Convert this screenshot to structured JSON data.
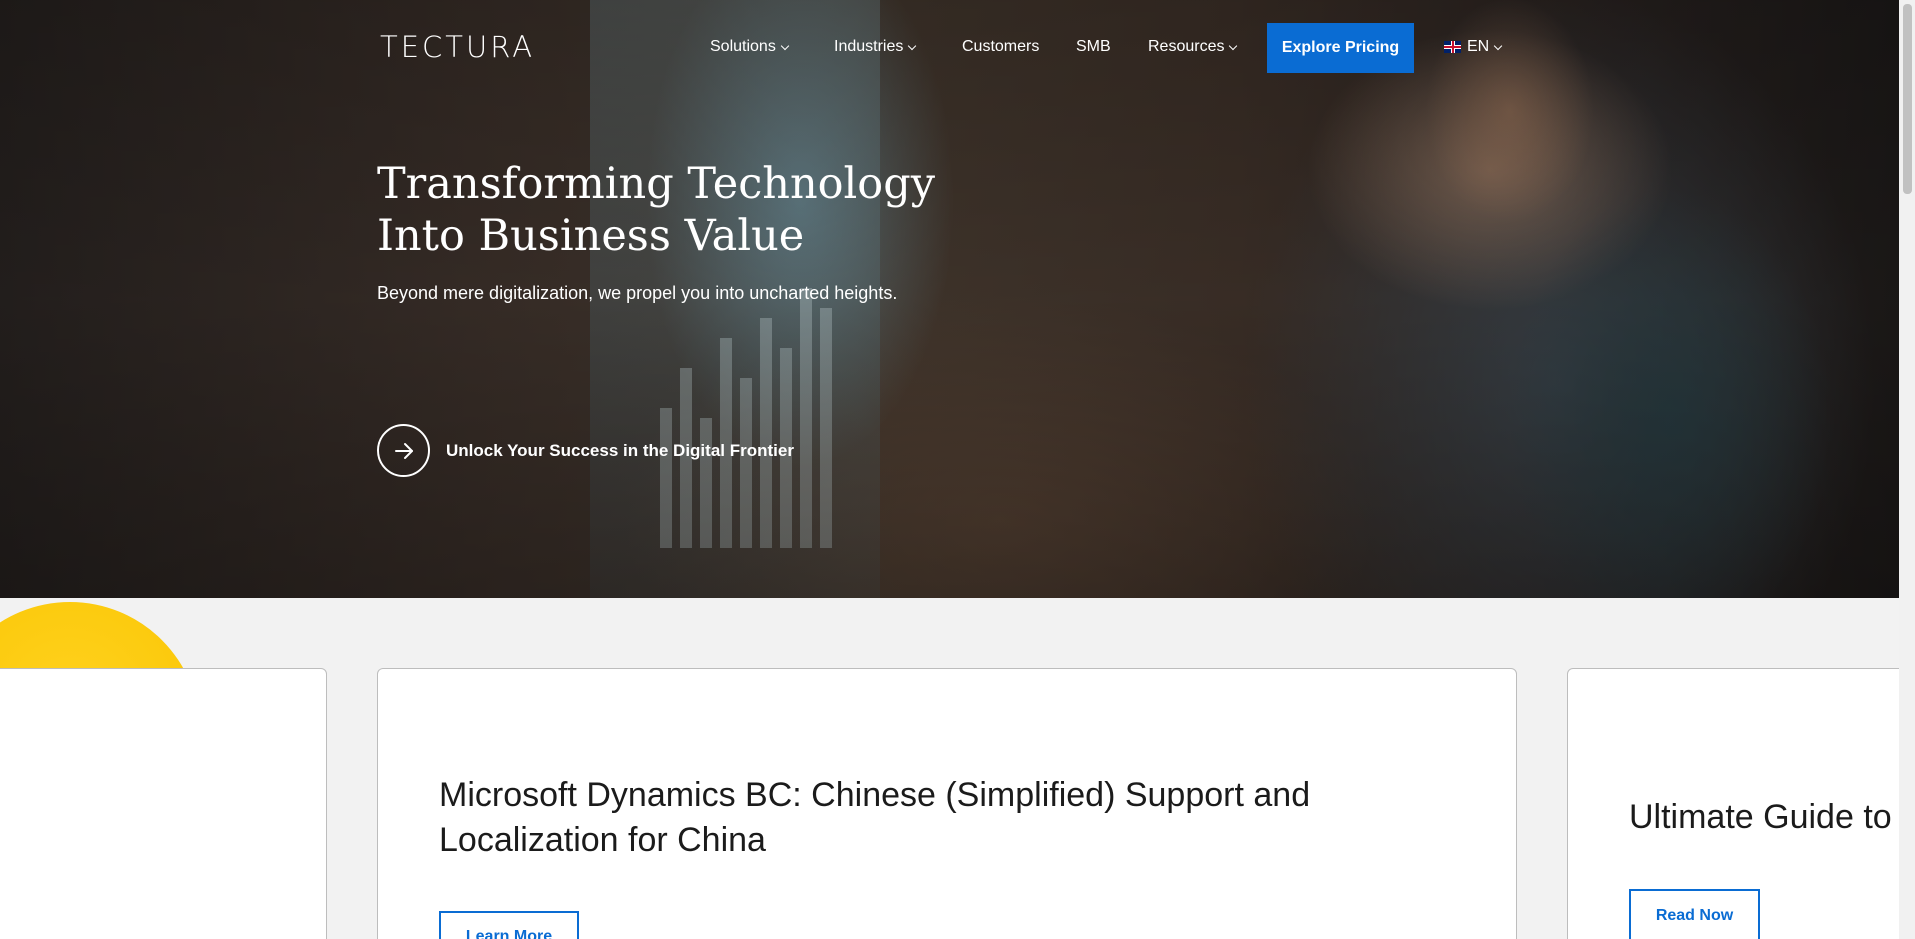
{
  "brand": {
    "logo_text": "TECTURA"
  },
  "nav": {
    "items": [
      {
        "label": "Solutions",
        "dropdown": true
      },
      {
        "label": "Industries",
        "dropdown": true
      },
      {
        "label": "Customers",
        "dropdown": false
      },
      {
        "label": "SMB",
        "dropdown": false
      },
      {
        "label": "Resources",
        "dropdown": true
      }
    ],
    "cta_label": "Explore Pricing",
    "language": "EN"
  },
  "hero": {
    "title_line1": "Transforming Technology",
    "title_line2": "Into Business Value",
    "subtitle": "Beyond mere digitalization, we propel you into uncharted heights.",
    "link_label": "Unlock Your Success in the Digital Frontier"
  },
  "cards": {
    "main": {
      "title": "Microsoft Dynamics BC: Chinese (Simplified) Support and Localization for China",
      "button_label": "Learn More"
    },
    "right": {
      "title": "Ultimate Guide to",
      "button_label": "Read Now"
    }
  },
  "colors": {
    "accent": "#0a6cd3",
    "highlight": "#ffd21f",
    "page_bg": "#f2f2f2"
  }
}
